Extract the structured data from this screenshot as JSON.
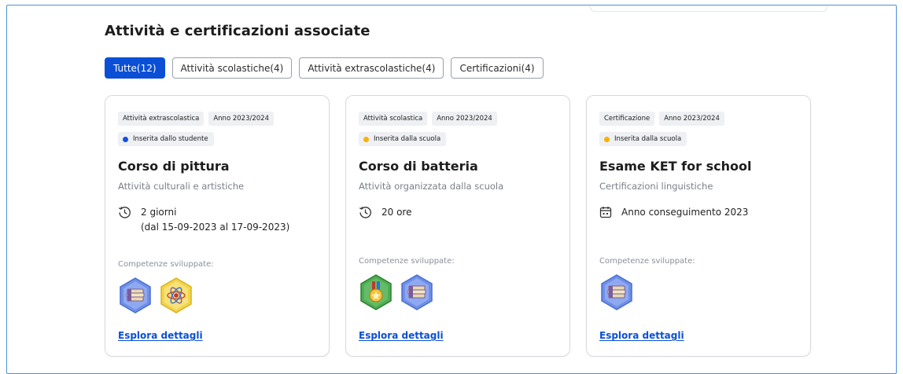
{
  "section_title": "Attività e certificazioni associate",
  "tabs": [
    {
      "label": "Tutte(12)",
      "active": true
    },
    {
      "label": "Attività scolastiche(4)",
      "active": false
    },
    {
      "label": "Attività extrascolastiche(4)",
      "active": false
    },
    {
      "label": "Certificazioni(4)",
      "active": false
    }
  ],
  "colors": {
    "accent": "#0a4fd6",
    "student_dot": "#1452e0",
    "school_dot": "#f5b20a"
  },
  "cards": [
    {
      "type_chip": "Attività extrascolastica",
      "year_chip": "Anno 2023/2024",
      "origin": "Inserita dallo studente",
      "title": "Corso di pittura",
      "subtitle": "Attività culturali e artistiche",
      "meta_icon": "clock-icon",
      "meta_line1": "2 giorni",
      "meta_line2": "(dal 15-09-2023 al 17-09-2023)",
      "skills_label": "Competenze sviluppate:",
      "badges": [
        "book-stack-badge-icon",
        "atom-badge-icon"
      ],
      "link": "Esplora dettagli"
    },
    {
      "type_chip": "Attività scolastica",
      "year_chip": "Anno 2023/2024",
      "origin": "Inserita dalla scuola",
      "title": "Corso di batteria",
      "subtitle": "Attività organizzata dalla scuola",
      "meta_icon": "clock-icon",
      "meta_line1": "20 ore",
      "skills_label": "Competenze sviluppate:",
      "badges": [
        "medal-badge-icon",
        "book-stack-badge-icon"
      ],
      "link": "Esplora dettagli"
    },
    {
      "type_chip": "Certificazione",
      "year_chip": "Anno 2023/2024",
      "origin": "Inserita dalla scuola",
      "title": "Esame KET for school",
      "subtitle": "Certificazioni linguistiche",
      "meta_icon": "calendar-icon",
      "meta_line1": "Anno conseguimento 2023",
      "skills_label": "Competenze sviluppate:",
      "badges": [
        "book-stack-badge-icon"
      ],
      "link": "Esplora dettagli"
    }
  ]
}
